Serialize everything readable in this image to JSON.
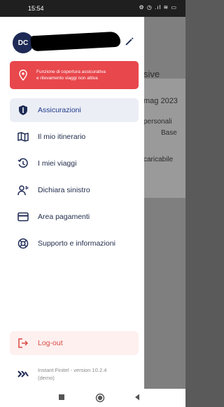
{
  "status_bar": {
    "time": "15:54",
    "icons": "⚙ ◷ .ıl ≋ ▭"
  },
  "background_page": {
    "title_fragment": "sive",
    "date_fragment": "mag 2023",
    "personal_fragment": "personali",
    "base_fragment": "Base",
    "loadable_fragment": "caricabile"
  },
  "drawer": {
    "avatar_initials": "DC",
    "alert": {
      "line1": "Funzione di copertura assicurativa",
      "line2": "e rilevamento viaggi non attiva"
    },
    "menu": [
      {
        "label": "Assicurazioni",
        "icon": "shield-icon"
      },
      {
        "label": "Il mio itinerario",
        "icon": "map-icon"
      },
      {
        "label": "I miei viaggi",
        "icon": "history-icon"
      },
      {
        "label": "Dichiara sinistro",
        "icon": "report-icon"
      },
      {
        "label": "Area pagamenti",
        "icon": "card-icon"
      },
      {
        "label": "Supporto e informazioni",
        "icon": "support-icon"
      }
    ],
    "logout_label": "Log-out",
    "version_line1": "Instant Finitel - version 10.2.4",
    "version_line2": "(demo)"
  },
  "colors": {
    "alert_red": "#e8474c",
    "active_bg": "#eceef6",
    "navy": "#1e2a55",
    "logout_text": "#d94a46"
  }
}
